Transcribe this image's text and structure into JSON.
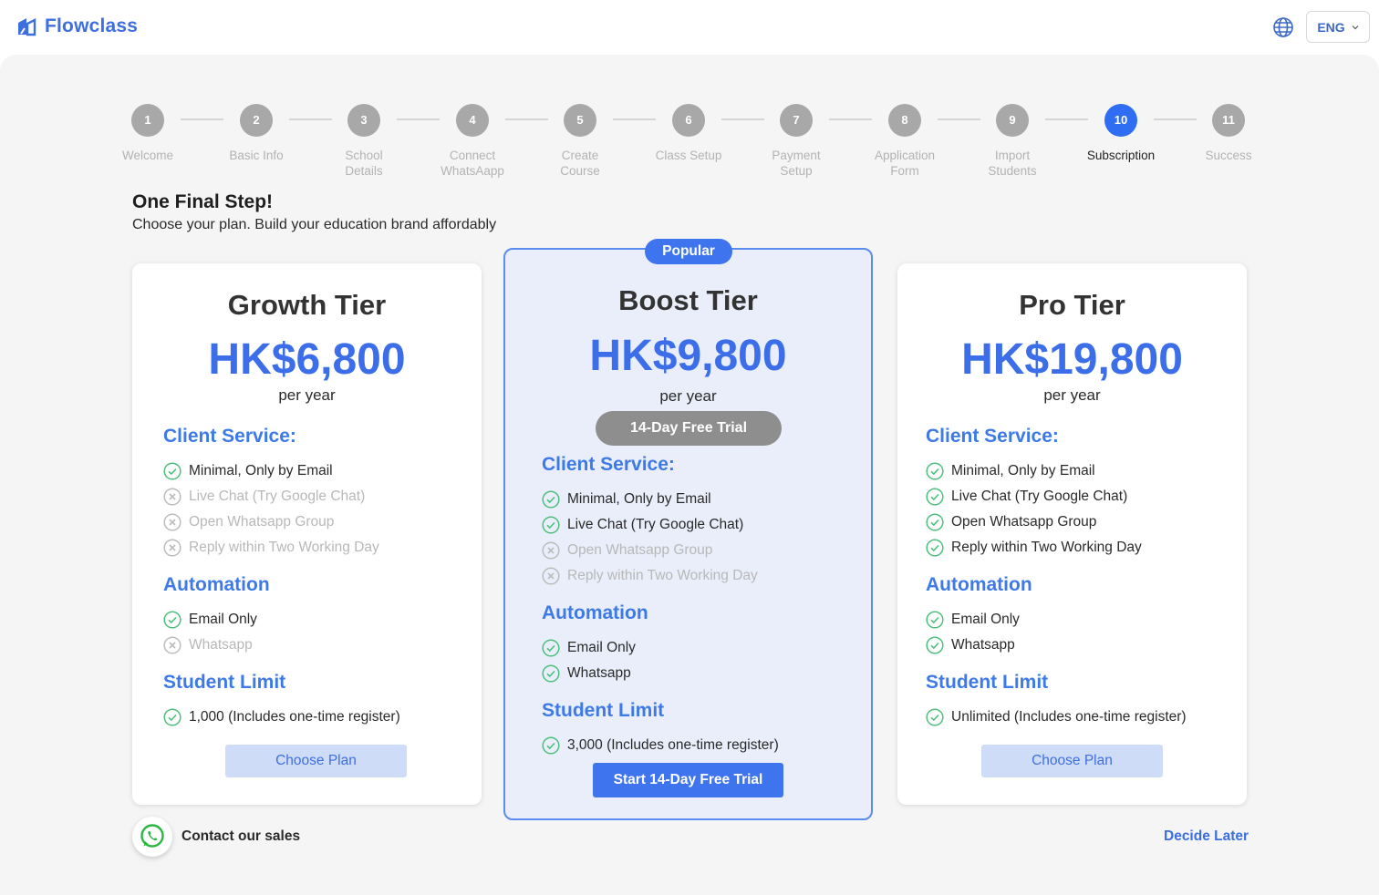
{
  "brand": {
    "name": "Flowclass",
    "color": "#3e6fe0"
  },
  "language": {
    "selected": "ENG"
  },
  "stepper": {
    "active_index": 9,
    "steps": [
      {
        "num": "1",
        "label": "Welcome"
      },
      {
        "num": "2",
        "label": "Basic Info"
      },
      {
        "num": "3",
        "label": "School Details"
      },
      {
        "num": "4",
        "label": "Connect WhatsAapp"
      },
      {
        "num": "5",
        "label": "Create Course"
      },
      {
        "num": "6",
        "label": "Class Setup"
      },
      {
        "num": "7",
        "label": "Payment Setup"
      },
      {
        "num": "8",
        "label": "Application Form"
      },
      {
        "num": "9",
        "label": "Import Students"
      },
      {
        "num": "10",
        "label": "Subscription"
      },
      {
        "num": "11",
        "label": "Success"
      }
    ]
  },
  "header": {
    "title": "One Final Step!",
    "subtitle": "Choose your plan. Build your education brand affordably"
  },
  "plans": {
    "growth": {
      "title": "Growth Tier",
      "price": "HK$6,800",
      "period": "per year",
      "client_service_title": "Client Service:",
      "client_service": [
        {
          "text": "Minimal, Only by Email",
          "included": true
        },
        {
          "text": "Live Chat (Try Google Chat)",
          "included": false
        },
        {
          "text": "Open Whatsapp Group",
          "included": false
        },
        {
          "text": "Reply within Two Working Day",
          "included": false
        }
      ],
      "automation_title": "Automation",
      "automation": [
        {
          "text": "Email Only",
          "included": true
        },
        {
          "text": "Whatsapp",
          "included": false
        }
      ],
      "limit_title": "Student Limit",
      "limit": [
        {
          "text": "1,000 (Includes one-time register)",
          "included": true
        }
      ],
      "button": "Choose Plan"
    },
    "boost": {
      "badge": "Popular",
      "title": "Boost Tier",
      "price": "HK$9,800",
      "period": "per year",
      "trial_pill": "14-Day Free Trial",
      "client_service_title": "Client Service:",
      "client_service": [
        {
          "text": "Minimal, Only by Email",
          "included": true
        },
        {
          "text": "Live Chat (Try Google Chat)",
          "included": true
        },
        {
          "text": "Open Whatsapp Group",
          "included": false
        },
        {
          "text": "Reply within Two Working Day",
          "included": false
        }
      ],
      "automation_title": "Automation",
      "automation": [
        {
          "text": "Email Only",
          "included": true
        },
        {
          "text": "Whatsapp",
          "included": true
        }
      ],
      "limit_title": "Student Limit",
      "limit": [
        {
          "text": "3,000 (Includes one-time register)",
          "included": true
        }
      ],
      "button": "Start 14-Day Free Trial"
    },
    "pro": {
      "title": "Pro Tier",
      "price": "HK$19,800",
      "period": "per year",
      "client_service_title": "Client Service:",
      "client_service": [
        {
          "text": "Minimal, Only by Email",
          "included": true
        },
        {
          "text": "Live Chat (Try Google Chat)",
          "included": true
        },
        {
          "text": "Open Whatsapp Group",
          "included": true
        },
        {
          "text": "Reply within Two Working Day",
          "included": true
        }
      ],
      "automation_title": "Automation",
      "automation": [
        {
          "text": "Email Only",
          "included": true
        },
        {
          "text": "Whatsapp",
          "included": true
        }
      ],
      "limit_title": "Student Limit",
      "limit": [
        {
          "text": "Unlimited (Includes one-time register)",
          "included": true
        }
      ],
      "button": "Choose Plan"
    }
  },
  "footer": {
    "contact": "Contact our sales",
    "decide_later": "Decide Later"
  },
  "icons": {
    "included": "check-circle-icon",
    "excluded": "x-circle-icon",
    "language": "globe-icon",
    "contact": "whatsapp-icon"
  },
  "colors": {
    "accent": "#2f6ef2",
    "check": "#4cc07a",
    "muted": "#b8b8b8"
  }
}
